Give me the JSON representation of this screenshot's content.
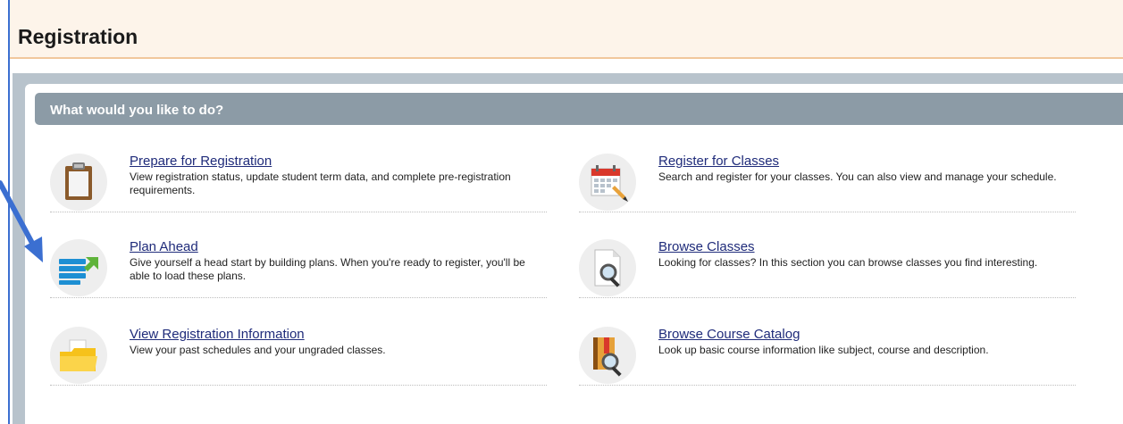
{
  "header": {
    "title": "Registration"
  },
  "section": {
    "title": "What would you like to do?"
  },
  "items": [
    {
      "title": "Prepare for Registration",
      "desc": "View registration status, update student term data, and complete pre-registration requirements.",
      "icon": "clipboard-icon"
    },
    {
      "title": "Register for Classes",
      "desc": "Search and register for your classes. You can also view and manage your schedule.",
      "icon": "calendar-icon"
    },
    {
      "title": "Plan Ahead",
      "desc": "Give yourself a head start by building plans. When you're ready to register, you'll be able to load these plans.",
      "icon": "plan-list-icon"
    },
    {
      "title": "Browse Classes",
      "desc": "Looking for classes? In this section you can browse classes you find interesting.",
      "icon": "document-search-icon"
    },
    {
      "title": "View Registration Information",
      "desc": "View your past schedules and your ungraded classes.",
      "icon": "folder-icon"
    },
    {
      "title": "Browse Course Catalog",
      "desc": "Look up basic course information like subject, course and description.",
      "icon": "catalog-search-icon"
    }
  ],
  "colors": {
    "link": "#1f2b7a",
    "header_bg": "#fdf4ea",
    "section_bar": "#8c9ba6",
    "annotation_arrow": "#3b6fd1"
  }
}
